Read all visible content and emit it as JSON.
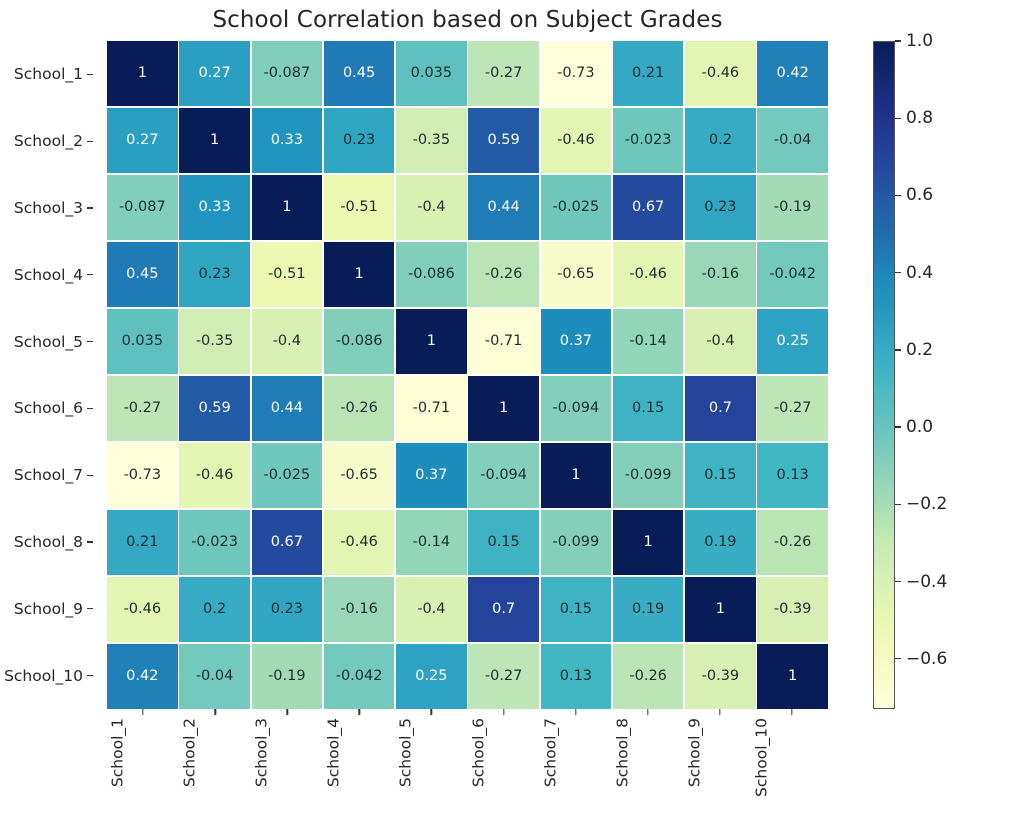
{
  "chart_data": {
    "type": "heatmap",
    "title": "School Correlation based on Subject Grades",
    "xlabel": "",
    "ylabel": "",
    "colormap": "YlGnBu",
    "grid": false,
    "legend_position": "right-colorbar",
    "vmin": -0.73,
    "vmax": 1.0,
    "colorbar_ticks": [
      "1.0",
      "0.8",
      "0.6",
      "0.4",
      "0.2",
      "0.0",
      "−0.2",
      "−0.4",
      "−0.6"
    ],
    "colorbar_tick_values": [
      1.0,
      0.8,
      0.6,
      0.4,
      0.2,
      0.0,
      -0.2,
      -0.4,
      -0.6
    ],
    "x_categories": [
      "School_1",
      "School_2",
      "School_3",
      "School_4",
      "School_5",
      "School_6",
      "School_7",
      "School_8",
      "School_9",
      "School_10"
    ],
    "y_categories": [
      "School_1",
      "School_2",
      "School_3",
      "School_4",
      "School_5",
      "School_6",
      "School_7",
      "School_8",
      "School_9",
      "School_10"
    ],
    "values": [
      [
        1,
        0.27,
        -0.087,
        0.45,
        0.035,
        -0.27,
        -0.73,
        0.21,
        -0.46,
        0.42
      ],
      [
        0.27,
        1,
        0.33,
        0.23,
        -0.35,
        0.59,
        -0.46,
        -0.023,
        0.2,
        -0.04
      ],
      [
        -0.087,
        0.33,
        1,
        -0.51,
        -0.4,
        0.44,
        -0.025,
        0.67,
        0.23,
        -0.19
      ],
      [
        0.45,
        0.23,
        -0.51,
        1,
        -0.086,
        -0.26,
        -0.65,
        -0.46,
        -0.16,
        -0.042
      ],
      [
        0.035,
        -0.35,
        -0.4,
        -0.086,
        1,
        -0.71,
        0.37,
        -0.14,
        -0.4,
        0.25
      ],
      [
        -0.27,
        0.59,
        0.44,
        -0.26,
        -0.71,
        1,
        -0.094,
        0.15,
        0.7,
        -0.27
      ],
      [
        -0.73,
        -0.46,
        -0.025,
        -0.65,
        0.37,
        -0.094,
        1,
        -0.099,
        0.15,
        0.13
      ],
      [
        0.21,
        -0.023,
        0.67,
        -0.46,
        -0.14,
        0.15,
        -0.099,
        1,
        0.19,
        -0.26
      ],
      [
        -0.46,
        0.2,
        0.23,
        -0.16,
        -0.4,
        0.7,
        0.15,
        0.19,
        1,
        -0.39
      ],
      [
        0.42,
        -0.04,
        -0.19,
        -0.042,
        0.25,
        -0.27,
        0.13,
        -0.26,
        -0.39,
        1
      ]
    ],
    "annotations": [
      [
        "1",
        "0.27",
        "-0.087",
        "0.45",
        "0.035",
        "-0.27",
        "-0.73",
        "0.21",
        "-0.46",
        "0.42"
      ],
      [
        "0.27",
        "1",
        "0.33",
        "0.23",
        "-0.35",
        "0.59",
        "-0.46",
        "-0.023",
        "0.2",
        "-0.04"
      ],
      [
        "-0.087",
        "0.33",
        "1",
        "-0.51",
        "-0.4",
        "0.44",
        "-0.025",
        "0.67",
        "0.23",
        "-0.19"
      ],
      [
        "0.45",
        "0.23",
        "-0.51",
        "1",
        "-0.086",
        "-0.26",
        "-0.65",
        "-0.46",
        "-0.16",
        "-0.042"
      ],
      [
        "0.035",
        "-0.35",
        "-0.4",
        "-0.086",
        "1",
        "-0.71",
        "0.37",
        "-0.14",
        "-0.4",
        "0.25"
      ],
      [
        "-0.27",
        "0.59",
        "0.44",
        "-0.26",
        "-0.71",
        "1",
        "-0.094",
        "0.15",
        "0.7",
        "-0.27"
      ],
      [
        "-0.73",
        "-0.46",
        "-0.025",
        "-0.65",
        "0.37",
        "-0.094",
        "1",
        "-0.099",
        "0.15",
        "0.13"
      ],
      [
        "0.21",
        "-0.023",
        "0.67",
        "-0.46",
        "-0.14",
        "0.15",
        "-0.099",
        "1",
        "0.19",
        "-0.26"
      ],
      [
        "-0.46",
        "0.2",
        "0.23",
        "-0.16",
        "-0.4",
        "0.7",
        "0.15",
        "0.19",
        "1",
        "-0.39"
      ],
      [
        "0.42",
        "-0.04",
        "-0.19",
        "-0.042",
        "0.25",
        "-0.27",
        "0.13",
        "-0.26",
        "-0.39",
        "1"
      ]
    ]
  },
  "colors": {
    "background": "#ffffff",
    "text": "#262626",
    "axis_line": "#333333",
    "cmap_stops": [
      "#ffffd9",
      "#edf8b1",
      "#c7e9b4",
      "#7fcdbb",
      "#41b6c4",
      "#1d91c0",
      "#225ea8",
      "#253494",
      "#081d58"
    ]
  }
}
